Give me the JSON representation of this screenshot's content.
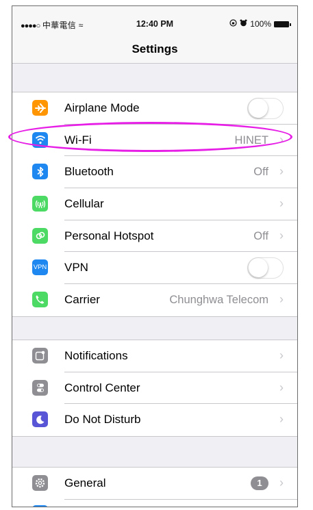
{
  "status_bar": {
    "signal": "●●●●○",
    "carrier": "中華電信",
    "wifi_symbol": "≈",
    "time": "12:40 PM",
    "icons": [
      "rotation-lock-icon",
      "alarm-icon"
    ],
    "battery_text": "100%"
  },
  "nav": {
    "title": "Settings"
  },
  "groups": [
    {
      "items": [
        {
          "label": "Airplane Mode",
          "icon": "airplane-icon",
          "icon_color": "#ff9500",
          "control": "toggle",
          "on": false
        },
        {
          "label": "Wi-Fi",
          "icon": "wifi-icon",
          "icon_color": "#1e88f0",
          "value": "HINET",
          "chevron": "›"
        },
        {
          "label": "Bluetooth",
          "icon": "bluetooth-icon",
          "icon_color": "#1e88f0",
          "value": "Off",
          "chevron": "›"
        },
        {
          "label": "Cellular",
          "icon": "cellular-icon",
          "icon_color": "#4cd964",
          "value": "",
          "chevron": "›"
        },
        {
          "label": "Personal Hotspot",
          "icon": "hotspot-icon",
          "icon_color": "#4cd964",
          "value": "Off",
          "chevron": "›"
        },
        {
          "label": "VPN",
          "icon": "vpn-icon",
          "icon_color": "#1e88f0",
          "icon_text": "VPN",
          "control": "toggle",
          "on": false
        },
        {
          "label": "Carrier",
          "icon": "phone-icon",
          "icon_color": "#4cd964",
          "value": "Chunghwa Telecom",
          "chevron": "›"
        }
      ]
    },
    {
      "items": [
        {
          "label": "Notifications",
          "icon": "notifications-icon",
          "icon_color": "#8e8e93",
          "value": "",
          "chevron": "›"
        },
        {
          "label": "Control Center",
          "icon": "control-center-icon",
          "icon_color": "#8e8e93",
          "value": "",
          "chevron": "›"
        },
        {
          "label": "Do Not Disturb",
          "icon": "moon-icon",
          "icon_color": "#5856d6",
          "value": "",
          "chevron": "›"
        }
      ]
    },
    {
      "items": [
        {
          "label": "General",
          "icon": "gear-icon",
          "icon_color": "#8e8e93",
          "badge": "1",
          "chevron": "›"
        }
      ]
    }
  ],
  "annotation": {
    "highlight_color": "#e61ee6",
    "target": "Wi-Fi"
  }
}
